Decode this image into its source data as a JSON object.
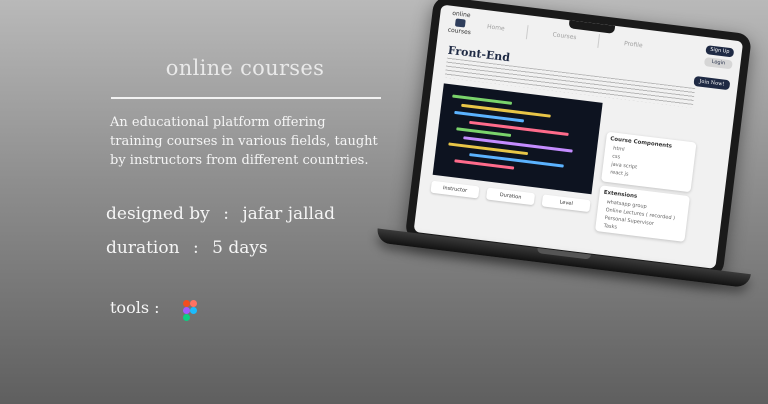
{
  "header": {
    "title": "online courses"
  },
  "description": "An educational platform offering training courses in various fields, taught by instructors from different countries.",
  "designed_by": {
    "label": "designed by",
    "separator": ":",
    "value": "jafar jallad"
  },
  "duration": {
    "label": "duration",
    "separator": ":",
    "value": "5 days"
  },
  "tools": {
    "label": "tools :",
    "icons": [
      "figma-icon"
    ]
  },
  "mockup": {
    "logo_top": "online",
    "logo_bottom": "courses",
    "nav": [
      "Home",
      "Courses",
      "Profile"
    ],
    "signup": "Sign Up",
    "login": "Login",
    "join": "Join Now!",
    "heading": "Front-End",
    "stats": [
      "Instructor",
      "Duration",
      "Level"
    ],
    "components": {
      "title": "Course Components",
      "items": [
        "html",
        "css",
        "java script",
        "react js"
      ]
    },
    "extensions": {
      "title": "Extensions",
      "items": [
        "whatsapp group",
        "Online Lectures ( recorded )",
        "Personal Supervisor",
        "Tasks"
      ]
    }
  },
  "colors": {
    "accent": "#1f2a44",
    "text_light": "#f5f5f5"
  }
}
